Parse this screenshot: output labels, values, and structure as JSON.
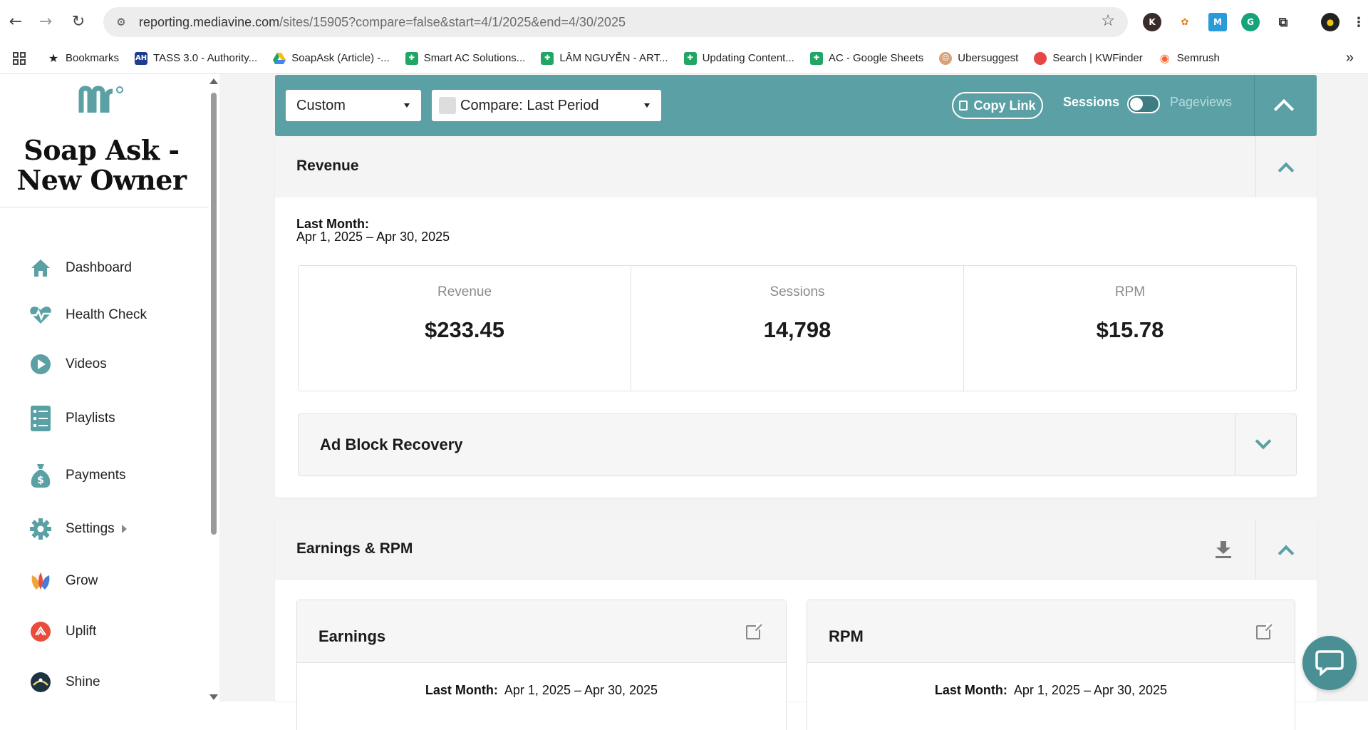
{
  "browser": {
    "url_host": "reporting.mediavine.com",
    "url_path": "/sites/15905?compare=false&start=4/1/2025&end=4/30/2025",
    "bookmarks": [
      {
        "label": "Bookmarks",
        "icon": "star-icon"
      },
      {
        "label": "TASS 3.0 - Authority...",
        "icon": "ah-icon"
      },
      {
        "label": "SoapAsk (Article) -...",
        "icon": "google-drive-icon"
      },
      {
        "label": "Smart AC Solutions...",
        "icon": "google-sheets-icon"
      },
      {
        "label": "LÂM NGUYỄN - ART...",
        "icon": "google-sheets-icon"
      },
      {
        "label": "Updating Content...",
        "icon": "google-sheets-icon"
      },
      {
        "label": "AC - Google Sheets",
        "icon": "google-sheets-icon"
      },
      {
        "label": "Ubersuggest",
        "icon": "ubersuggest-icon"
      },
      {
        "label": "Search | KWFinder",
        "icon": "kwfinder-icon"
      },
      {
        "label": "Semrush",
        "icon": "semrush-icon"
      }
    ]
  },
  "sidebar": {
    "site_title_line1": "Soap Ask -",
    "site_title_line2": "New Owner",
    "items": [
      {
        "label": "Dashboard",
        "icon": "home-icon"
      },
      {
        "label": "Health Check",
        "icon": "heartbeat-icon"
      },
      {
        "label": "Videos",
        "icon": "play-icon"
      },
      {
        "label": "Playlists",
        "icon": "playlist-icon"
      },
      {
        "label": "Payments",
        "icon": "money-bag-icon"
      },
      {
        "label": "Settings",
        "icon": "gear-icon"
      },
      {
        "label": "Grow",
        "icon": "grow-icon"
      },
      {
        "label": "Uplift",
        "icon": "uplift-icon"
      },
      {
        "label": "Shine",
        "icon": "shine-icon"
      }
    ]
  },
  "toolbar": {
    "date_select": "Custom",
    "compare_select": "Compare: Last Period",
    "copy_link": "Copy Link",
    "toggle_left": "Sessions",
    "toggle_right": "Pageviews",
    "accent": "#5aa0a4"
  },
  "revenue": {
    "title": "Revenue",
    "period_label": "Last Month:",
    "period_range": "Apr 1, 2025 – Apr 30, 2025",
    "metrics": [
      {
        "label": "Revenue",
        "value": "$233.45"
      },
      {
        "label": "Sessions",
        "value": "14,798"
      },
      {
        "label": "RPM",
        "value": "$15.78"
      }
    ],
    "ad_block": "Ad Block Recovery"
  },
  "earnings": {
    "title": "Earnings & RPM",
    "cards": [
      {
        "title": "Earnings",
        "period_label": "Last Month:",
        "period_range": "Apr 1, 2025 – Apr 30, 2025"
      },
      {
        "title": "RPM",
        "period_label": "Last Month:",
        "period_range": "Apr 1, 2025 – Apr 30, 2025"
      }
    ]
  }
}
